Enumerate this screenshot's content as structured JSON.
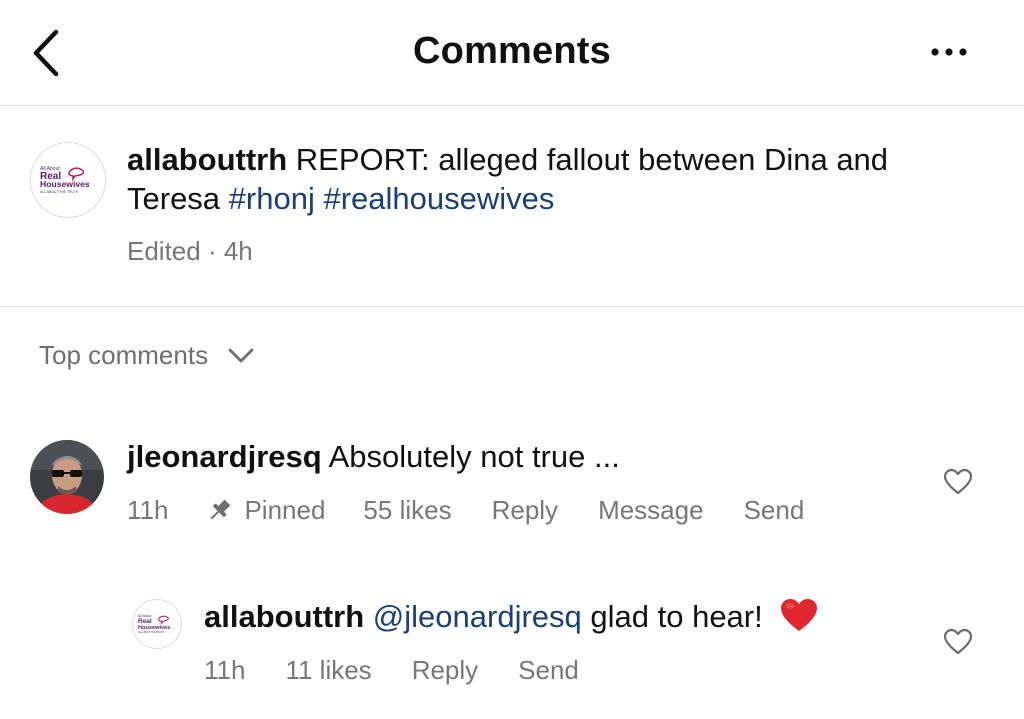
{
  "header": {
    "title": "Comments",
    "back_icon": "chevron-left-icon",
    "more_icon": "more-horizontal-icon"
  },
  "brand_logo": {
    "line1": "All About",
    "line2": "Real",
    "line3": "Housewives",
    "line4": "ALL ABOUT THE TRUTH",
    "color": "#5a1a6b"
  },
  "post": {
    "username": "allabouttrh",
    "caption": "REPORT: alleged fallout between Dina and Teresa",
    "hashtags": [
      "#rhonj",
      "#realhousewives"
    ],
    "meta": "Edited · 4h"
  },
  "sort": {
    "label": "Top comments"
  },
  "comments": [
    {
      "username": "jleonardjresq",
      "text": "Absolutely not true ...",
      "time": "11h",
      "pinned": "Pinned",
      "likes": "55 likes",
      "reply": "Reply",
      "message": "Message",
      "send": "Send"
    }
  ],
  "replies": [
    {
      "username": "allabouttrh",
      "mention": "@jleonardjresq",
      "text": "glad to hear!",
      "emoji": "red-heart",
      "time": "11h",
      "likes": "11 likes",
      "reply": "Reply",
      "send": "Send"
    }
  ],
  "colors": {
    "link": "#1a3f7a",
    "muted": "#777777",
    "divider": "#e2e2e2",
    "heart": "#e0262f"
  }
}
